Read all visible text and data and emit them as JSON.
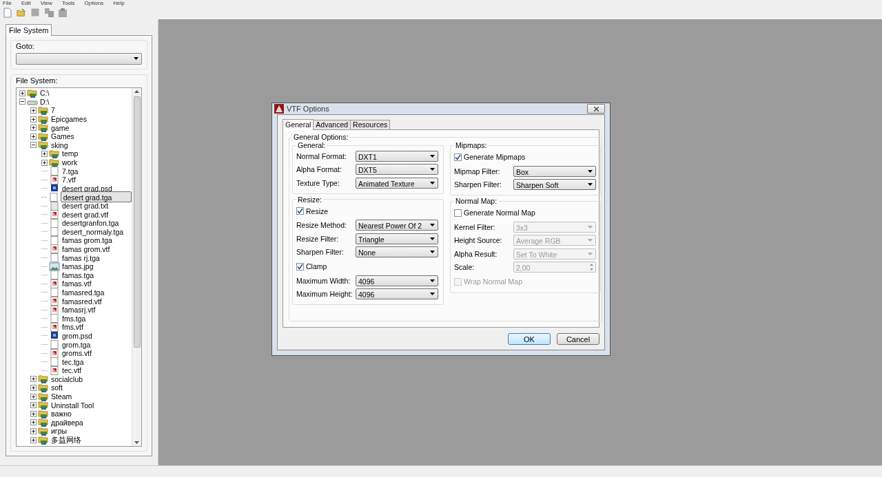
{
  "menu": [
    "File",
    "Edit",
    "View",
    "Tools",
    "Options",
    "Help"
  ],
  "toolbar": [
    {
      "kind": "new",
      "disabled": false
    },
    {
      "kind": "open",
      "disabled": false
    },
    {
      "kind": "save",
      "disabled": true
    },
    {
      "kind": "copy",
      "disabled": true
    },
    {
      "kind": "paste",
      "disabled": true
    }
  ],
  "sidebar": {
    "tab": {
      "label": "File System",
      "selected": true
    },
    "goto_label": "Goto:",
    "tree_label": "File System:",
    "tree": [
      {
        "label": "C:\\",
        "kind": "folder",
        "expanded": false,
        "selected": false
      },
      {
        "label": "D:\\",
        "kind": "drive",
        "expanded": true,
        "selected": false,
        "children": [
          {
            "label": "7",
            "kind": "folder",
            "expanded": false,
            "selected": false
          },
          {
            "label": "Epicgames",
            "kind": "folder",
            "expanded": false,
            "selected": false
          },
          {
            "label": "game",
            "kind": "folder",
            "expanded": false,
            "selected": false
          },
          {
            "label": "Games",
            "kind": "folder",
            "expanded": false,
            "selected": false
          },
          {
            "label": "sking",
            "kind": "folder",
            "expanded": true,
            "selected": false,
            "children": [
              {
                "label": "temp",
                "kind": "folder",
                "expanded": false,
                "selected": false
              },
              {
                "label": "work",
                "kind": "folder",
                "expanded": false,
                "selected": false
              },
              {
                "label": "7.tga",
                "kind": "file",
                "selected": false
              },
              {
                "label": "7.vtf",
                "kind": "vtf",
                "selected": false
              },
              {
                "label": "desert grad.psd",
                "kind": "psd",
                "selected": false
              },
              {
                "label": "desert grad.tga",
                "kind": "file",
                "selected": true
              },
              {
                "label": "desert grad.txt",
                "kind": "txt",
                "selected": false
              },
              {
                "label": "desert grad.vtf",
                "kind": "vtf",
                "selected": false
              },
              {
                "label": "desertgranfon.tga",
                "kind": "file",
                "selected": false
              },
              {
                "label": "desert_normaly.tga",
                "kind": "file",
                "selected": false
              },
              {
                "label": "famas grom.tga",
                "kind": "file",
                "selected": false
              },
              {
                "label": "famas grom.vtf",
                "kind": "vtf",
                "selected": false
              },
              {
                "label": "famas rj.tga",
                "kind": "file",
                "selected": false
              },
              {
                "label": "famas.jpg",
                "kind": "jpg",
                "selected": false
              },
              {
                "label": "famas.tga",
                "kind": "file",
                "selected": false
              },
              {
                "label": "famas.vtf",
                "kind": "vtf",
                "selected": false
              },
              {
                "label": "famasred.tga",
                "kind": "file",
                "selected": false
              },
              {
                "label": "famasred.vtf",
                "kind": "vtf",
                "selected": false
              },
              {
                "label": "famasrj.vtf",
                "kind": "vtf",
                "selected": false
              },
              {
                "label": "fms.tga",
                "kind": "file",
                "selected": false
              },
              {
                "label": "fms.vtf",
                "kind": "vtf",
                "selected": false
              },
              {
                "label": "grom.psd",
                "kind": "psd",
                "selected": false
              },
              {
                "label": "grom.tga",
                "kind": "file",
                "selected": false
              },
              {
                "label": "groms.vtf",
                "kind": "vtf",
                "selected": false
              },
              {
                "label": "tec.tga",
                "kind": "file",
                "selected": false
              },
              {
                "label": "tec.vtf",
                "kind": "vtf",
                "selected": false
              }
            ]
          },
          {
            "label": "socialclub",
            "kind": "folder",
            "expanded": false,
            "selected": false
          },
          {
            "label": "soft",
            "kind": "folder",
            "expanded": false,
            "selected": false
          },
          {
            "label": "Steam",
            "kind": "folder",
            "expanded": false,
            "selected": false
          },
          {
            "label": "Uninstall Tool",
            "kind": "folder",
            "expanded": false,
            "selected": false
          },
          {
            "label": "важно",
            "kind": "folder",
            "expanded": false,
            "selected": false
          },
          {
            "label": "драйвера",
            "kind": "folder",
            "expanded": false,
            "selected": false
          },
          {
            "label": "игры",
            "kind": "folder",
            "expanded": false,
            "selected": false
          },
          {
            "label": "多益网络",
            "kind": "folder",
            "expanded": false,
            "selected": false
          }
        ]
      }
    ]
  },
  "dialog": {
    "title": "VTF Options",
    "tabs": [
      {
        "label": "General",
        "selected": true
      },
      {
        "label": "Advanced",
        "selected": false
      },
      {
        "label": "Resources",
        "selected": false
      }
    ],
    "group_title": "General Options:",
    "columns": [
      [
        {
          "title": "General:",
          "rows": [
            {
              "kind": "select",
              "label": "Normal Format:",
              "value": "DXT1",
              "disabled": false
            },
            {
              "kind": "select",
              "label": "Alpha Format:",
              "value": "DXT5",
              "disabled": false
            },
            {
              "kind": "select",
              "label": "Texture Type:",
              "value": "Animated Texture",
              "disabled": false
            }
          ]
        },
        {
          "title": "Resize:",
          "rows": [
            {
              "kind": "checkbox",
              "label": "Resize",
              "checked": true,
              "disabled": false
            },
            {
              "kind": "select",
              "label": "Resize Method:",
              "value": "Nearest Power Of 2",
              "disabled": false
            },
            {
              "kind": "select",
              "label": "Resize Filter:",
              "value": "Triangle",
              "disabled": false
            },
            {
              "kind": "select",
              "label": "Sharpen Filter:",
              "value": "None",
              "disabled": false
            },
            {
              "kind": "checkbox",
              "label": "Clamp",
              "checked": true,
              "disabled": false
            },
            {
              "kind": "select",
              "label": "Maximum Width:",
              "value": "4096",
              "disabled": false
            },
            {
              "kind": "select",
              "label": "Maximum Height:",
              "value": "4096",
              "disabled": false
            }
          ]
        }
      ],
      [
        {
          "title": "Mipmaps:",
          "rows": [
            {
              "kind": "checkbox",
              "label": "Generate Mipmaps",
              "checked": true,
              "disabled": false
            },
            {
              "kind": "select",
              "label": "Mipmap Filter:",
              "value": "Box",
              "disabled": false
            },
            {
              "kind": "select",
              "label": "Sharpen Filter:",
              "value": "Sharpen Soft",
              "disabled": false
            }
          ]
        },
        {
          "title": "Normal Map:",
          "rows": [
            {
              "kind": "checkbox",
              "label": "Generate Normal Map",
              "checked": false,
              "disabled": false
            },
            {
              "kind": "select",
              "label": "Kernel Filter:",
              "value": "3x3",
              "disabled": true
            },
            {
              "kind": "select",
              "label": "Height Source:",
              "value": "Average RGB",
              "disabled": true
            },
            {
              "kind": "select",
              "label": "Alpha Result:",
              "value": "Set To White",
              "disabled": true
            },
            {
              "kind": "spin",
              "label": "Scale:",
              "value": "2,00",
              "disabled": true
            },
            {
              "kind": "checkbox",
              "label": "Wrap Normal Map",
              "checked": false,
              "disabled": true
            }
          ]
        }
      ]
    ],
    "buttons": [
      {
        "label": "OK",
        "default": true
      },
      {
        "label": "Cancel",
        "default": false
      }
    ]
  }
}
